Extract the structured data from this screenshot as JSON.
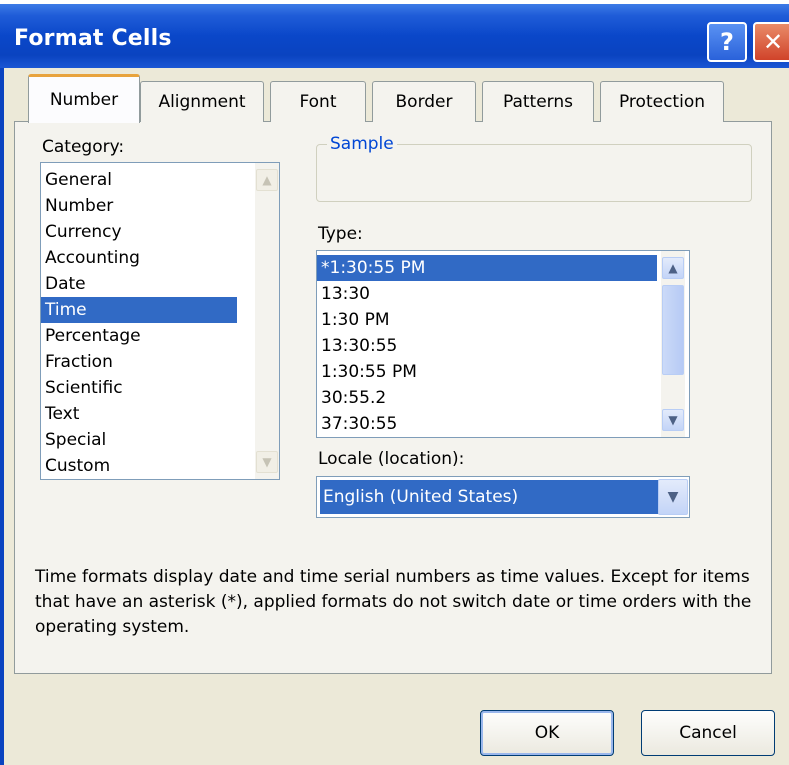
{
  "window": {
    "title": "Format Cells",
    "help_glyph": "?",
    "close_glyph": "✕"
  },
  "tabs": [
    {
      "label": "Number"
    },
    {
      "label": "Alignment"
    },
    {
      "label": "Font"
    },
    {
      "label": "Border"
    },
    {
      "label": "Patterns"
    },
    {
      "label": "Protection"
    }
  ],
  "category": {
    "label": "Category:",
    "items": [
      "General",
      "Number",
      "Currency",
      "Accounting",
      "Date",
      "Time",
      "Percentage",
      "Fraction",
      "Scientific",
      "Text",
      "Special",
      "Custom"
    ],
    "selected": "Time"
  },
  "sample": {
    "label": "Sample",
    "value": ""
  },
  "type": {
    "label": "Type:",
    "items": [
      "*1:30:55 PM",
      "13:30",
      "1:30 PM",
      "13:30:55",
      "1:30:55 PM",
      "30:55.2",
      "37:30:55"
    ],
    "selected": "*1:30:55 PM"
  },
  "locale": {
    "label": "Locale (location):",
    "value": "English (United States)"
  },
  "description": "Time formats display date and time serial numbers as time values. Except for items that have an asterisk (*), applied formats do not switch date or time orders with the operating system.",
  "buttons": {
    "ok": "OK",
    "cancel": "Cancel"
  },
  "icons": {
    "scroll_up": "▲",
    "scroll_down": "▼",
    "dropdown": "▼"
  },
  "colors": {
    "selection": "#316ac5",
    "titlebar": "#0a47c9",
    "accent_tab": "#e8a33d"
  }
}
